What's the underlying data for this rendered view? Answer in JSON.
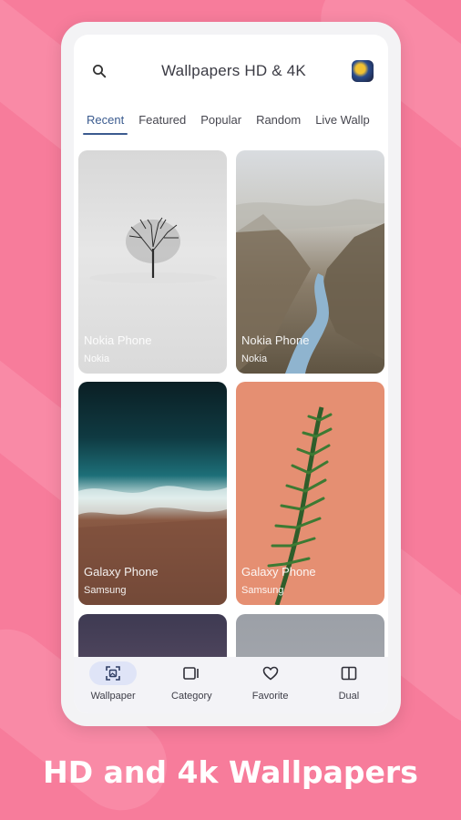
{
  "header": {
    "title": "Wallpapers HD & 4K",
    "search_icon": "search-icon",
    "avatar_icon": "profile-avatar"
  },
  "tabs": [
    {
      "label": "Recent",
      "active": true
    },
    {
      "label": "Featured",
      "active": false
    },
    {
      "label": "Popular",
      "active": false
    },
    {
      "label": "Random",
      "active": false
    },
    {
      "label": "Live Wallp",
      "active": false
    }
  ],
  "wallpapers": [
    {
      "title": "Nokia Phone",
      "subtitle": "Nokia"
    },
    {
      "title": "Nokia Phone",
      "subtitle": "Nokia"
    },
    {
      "title": "Galaxy Phone",
      "subtitle": "Samsung"
    },
    {
      "title": "Galaxy Phone",
      "subtitle": "Samsung"
    }
  ],
  "bottom_nav": [
    {
      "label": "Wallpaper",
      "icon": "wallpaper-icon",
      "active": true
    },
    {
      "label": "Category",
      "icon": "category-icon",
      "active": false
    },
    {
      "label": "Favorite",
      "icon": "heart-icon",
      "active": false
    },
    {
      "label": "Dual",
      "icon": "dual-icon",
      "active": false
    }
  ],
  "caption": "HD and 4k Wallpapers",
  "colors": {
    "background": "#f77c9b",
    "accent": "#3b5b8f",
    "active_nav_pill": "#dfe4f7"
  }
}
